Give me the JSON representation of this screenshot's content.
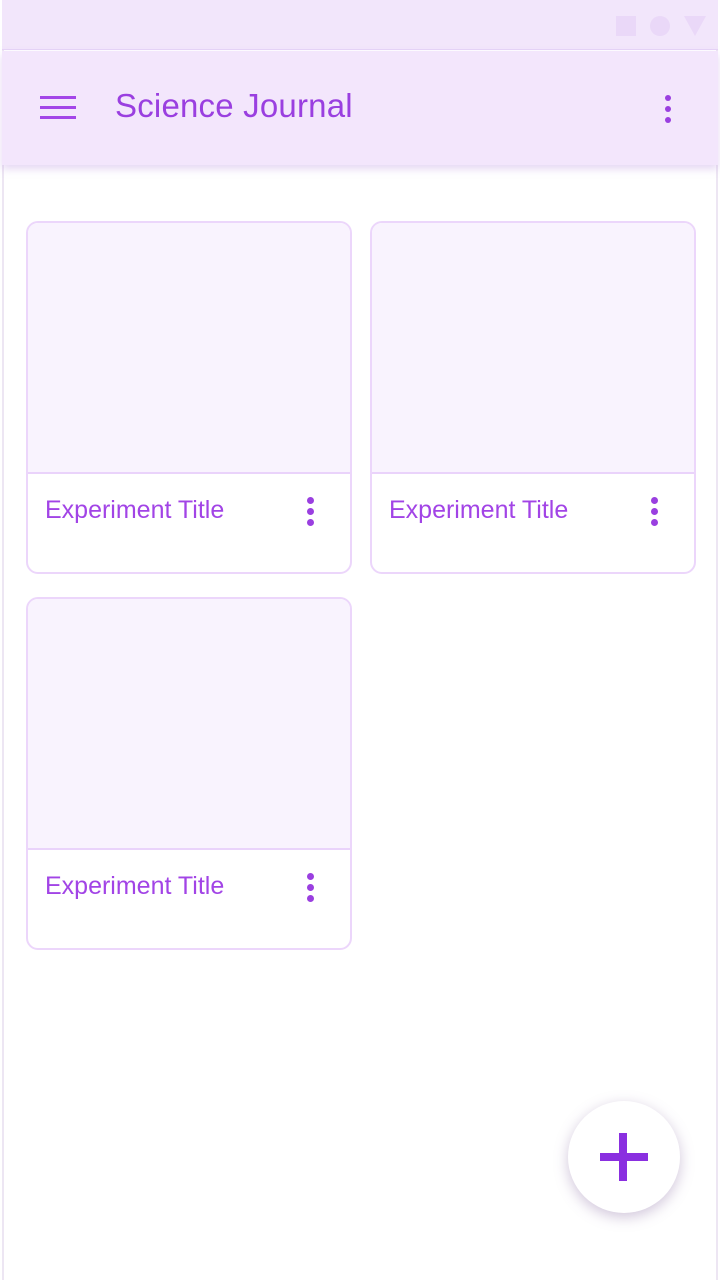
{
  "app_bar": {
    "title": "Science Journal",
    "menu_icon": "hamburger-menu-icon",
    "overflow_icon": "more-vert-icon"
  },
  "status_bar": {
    "icons": [
      "square-icon",
      "circle-icon",
      "triangle-icon"
    ]
  },
  "experiments": [
    {
      "title": "Experiment Title"
    },
    {
      "title": "Experiment Title"
    },
    {
      "title": "Experiment Title"
    }
  ],
  "fab": {
    "icon": "add-icon"
  },
  "colors": {
    "accent": "#9a3fe0",
    "app_bar_bg": "#f3e6fc",
    "card_image_bg": "#f9f3fe",
    "card_border": "#ecd6fb"
  }
}
